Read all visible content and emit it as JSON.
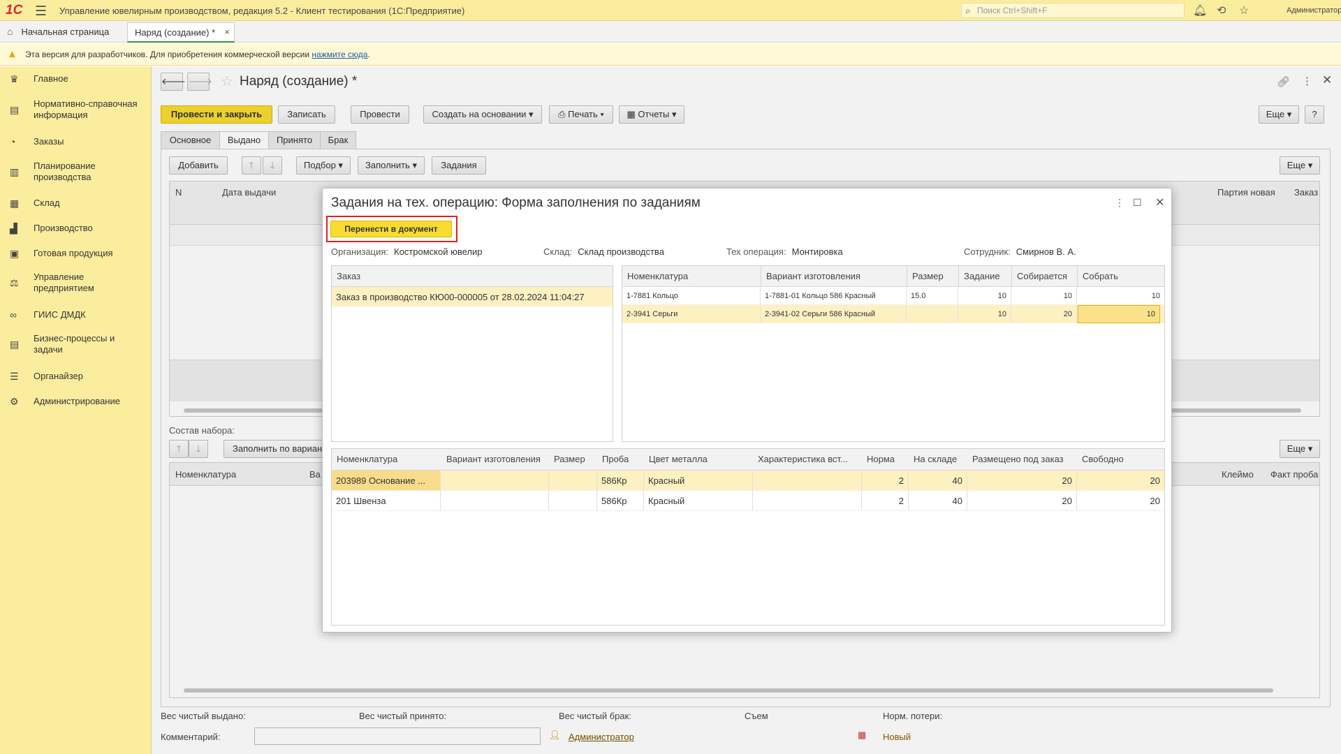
{
  "app": {
    "title": "Управление ювелирным производством, редакция 5.2  - Клиент тестирования (1С:Предприятие)",
    "logo": "1С",
    "search_placeholder": "Поиск Ctrl+Shift+F",
    "user": "Администратор"
  },
  "tabs": {
    "home": "Начальная страница",
    "doc": "Наряд (создание) *"
  },
  "warning": {
    "text": "Эта версия для разработчиков. Для приобретения коммерческой версии ",
    "link": "нажмите сюда",
    "end": "."
  },
  "sidebar": {
    "items": [
      {
        "label": "Главное",
        "icon": "crown-icon"
      },
      {
        "label": "Нормативно-справочная информация",
        "icon": "book-icon"
      },
      {
        "label": "Заказы",
        "icon": "pie-icon"
      },
      {
        "label": "Планирование производства",
        "icon": "clipboard-icon"
      },
      {
        "label": "Склад",
        "icon": "grid-icon"
      },
      {
        "label": "Производство",
        "icon": "factory-icon"
      },
      {
        "label": "Готовая продукция",
        "icon": "bag-icon"
      },
      {
        "label": "Управление предприятием",
        "icon": "org-icon"
      },
      {
        "label": "ГИИС ДМДК",
        "icon": "link-icon"
      },
      {
        "label": "Бизнес-процессы и задачи",
        "icon": "tasks-icon"
      },
      {
        "label": "Органайзер",
        "icon": "organizer-icon"
      },
      {
        "label": "Администрирование",
        "icon": "gear-icon"
      }
    ]
  },
  "form": {
    "title": "Наряд (создание) *",
    "buttons": {
      "post_close": "Провести и закрыть",
      "save": "Записать",
      "post": "Провести",
      "create_based": "Создать на основании",
      "print": "Печать",
      "reports": "Отчеты",
      "more": "Еще",
      "help": "?"
    },
    "tabs": [
      "Основное",
      "Выдано",
      "Принято",
      "Брак"
    ],
    "issued": {
      "buttons": {
        "add": "Добавить",
        "select": "Подбор",
        "fill": "Заполнить",
        "tasks": "Задания",
        "more": "Еще"
      },
      "columns": {
        "n": "N",
        "date": "Дата выдачи",
        "batch": "Партия новая",
        "order": "Заказ"
      }
    },
    "kit": {
      "label": "Состав набора:",
      "fill_button": "Заполнить по вариан",
      "more": "Еще",
      "columns": {
        "nom": "Номенклатура",
        "var": "Ва",
        "brand": "Клеймо",
        "fact": "Факт проба"
      }
    },
    "footer": {
      "net_issued": "Вес чистый выдано:",
      "net_received": "Вес чистый принято:",
      "net_defect": "Вес чистый брак:",
      "removal": "Съем",
      "norm_loss": "Норм. потери:",
      "comment": "Комментарий:",
      "author": "Администратор",
      "status": "Новый"
    }
  },
  "modal": {
    "title": "Задания на тех. операцию: Форма заполнения по заданиям",
    "transfer_button": "Перенести в документ",
    "org_label": "Организация:",
    "org": "Костромской ювелир",
    "wh_label": "Склад:",
    "wh": "Склад производства",
    "op_label": "Тех операция:",
    "op": "Монтировка",
    "emp_label": "Сотрудник:",
    "emp": "Смирнов В. А.",
    "orders": {
      "header": "Заказ",
      "rows": [
        "Заказ в производство КЮ00-000005 от 28.02.2024 11:04:27"
      ]
    },
    "tasks": {
      "columns": [
        "Номенклатура",
        "Вариант изготовления",
        "Размер",
        "Задание",
        "Собирается",
        "Собрать"
      ],
      "rows": [
        {
          "nom": "1-7881 Кольцо",
          "var": "1-7881-01 Кольцо 586 Красный",
          "size": "15.0",
          "task": "10",
          "assembling": "10",
          "assemble": "10"
        },
        {
          "nom": "2-3941 Серьги",
          "var": "2-3941-02 Серьги 586 Красный",
          "size": "",
          "task": "10",
          "assembling": "20",
          "assemble": "10"
        }
      ]
    },
    "materials": {
      "columns": [
        "Номенклатура",
        "Вариант изготовления",
        "Размер",
        "Проба",
        "Цвет металла",
        "Характеристика вст...",
        "Норма",
        "На складе",
        "Размещено под заказ",
        "Свободно"
      ],
      "rows": [
        {
          "nom": "203989 Основание ...",
          "var": "",
          "size": "",
          "probe": "586Кр",
          "color": "Красный",
          "char": "",
          "norm": "2",
          "stock": "40",
          "reserved": "20",
          "free": "20"
        },
        {
          "nom": "201 Швенза",
          "var": "",
          "size": "",
          "probe": "586Кр",
          "color": "Красный",
          "char": "",
          "norm": "2",
          "stock": "40",
          "reserved": "20",
          "free": "20"
        }
      ]
    }
  },
  "colors": {
    "accent_yellow": "#f9dc2f",
    "sidebar": "#fbed9e",
    "highlight_row": "#fdf1c2",
    "red_frame": "#e02020"
  }
}
